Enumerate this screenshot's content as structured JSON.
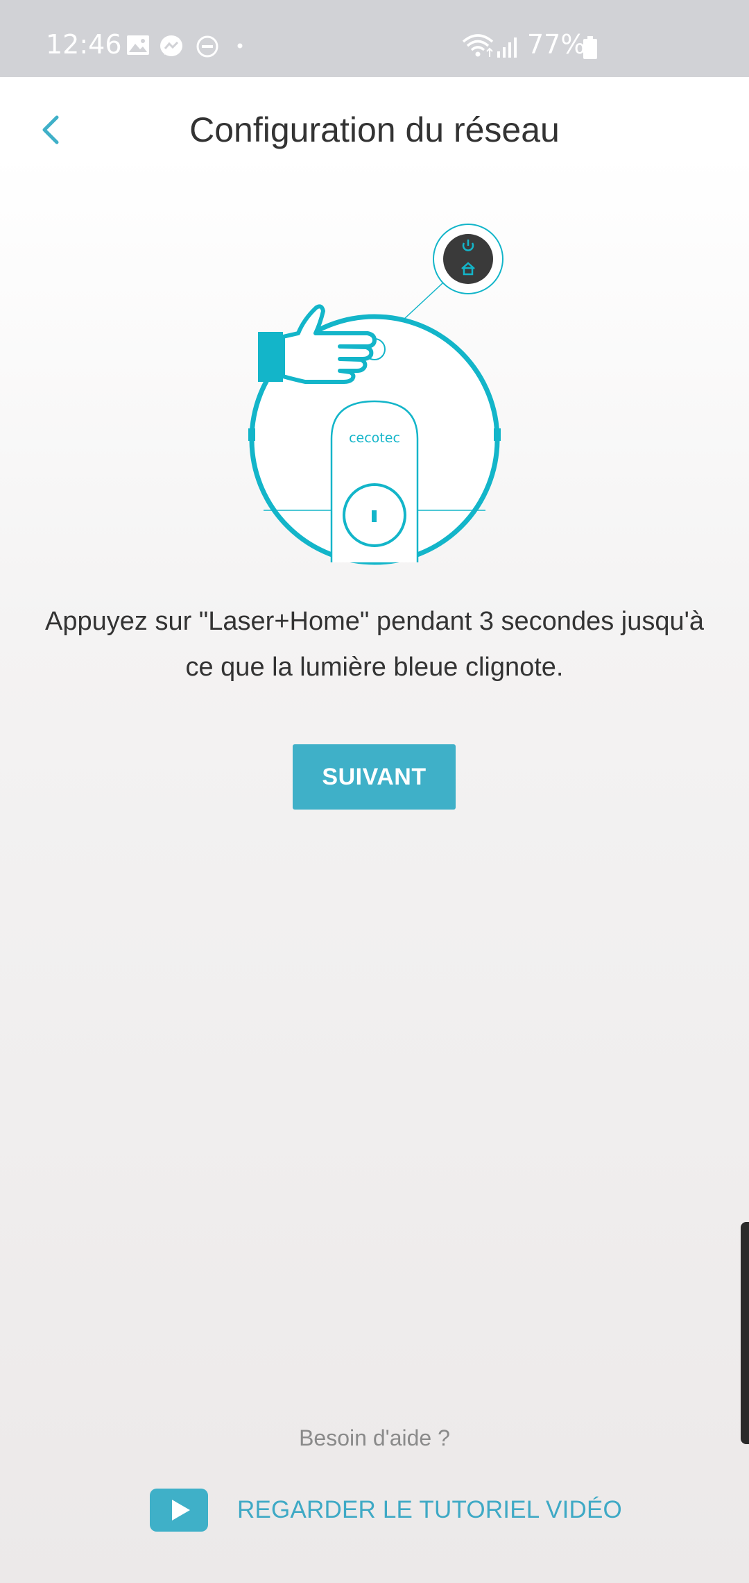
{
  "status_bar": {
    "time": "12:46",
    "battery": "77%",
    "icons": [
      "image-icon",
      "messenger-icon",
      "do-not-disturb-icon",
      "dot-icon",
      "wifi-icon",
      "signal-icon",
      "battery-icon"
    ]
  },
  "header": {
    "title": "Configuration du réseau",
    "back_icon": "chevron-left-icon"
  },
  "illustration": {
    "brand": "cecotec"
  },
  "instruction": "Appuyez sur \"Laser+Home\" pendant 3 secondes jusqu'à ce que la lumière bleue clignote.",
  "next_button": "SUIVANT",
  "help": {
    "question": "Besoin d'aide ?",
    "tutorial_label": "REGARDER LE TUTORIEL VIDÉO"
  },
  "colors": {
    "accent": "#3fb0c8",
    "illustration": "#13b5c9",
    "status_bar": "#d1d2d6",
    "title_text": "#333333"
  }
}
